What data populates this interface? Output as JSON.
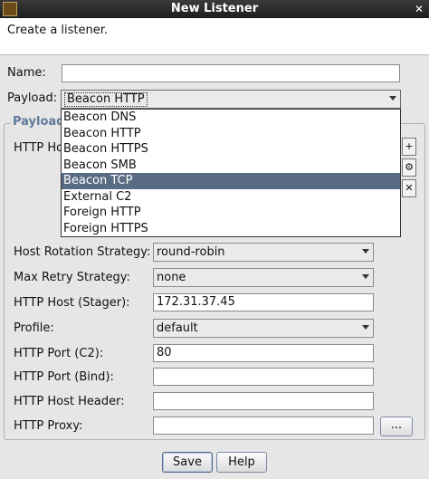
{
  "window": {
    "title": "New Listener",
    "close_glyph": "✕"
  },
  "header": {
    "text": "Create a listener."
  },
  "form": {
    "name_label": "Name:",
    "name_value": "",
    "payload_label": "Payload:",
    "payload_value": "Beacon HTTP",
    "group_title": "Payload",
    "partial_label": "HTTP Ho"
  },
  "dropdown": {
    "options": [
      "Beacon DNS",
      "Beacon HTTP",
      "Beacon HTTPS",
      "Beacon SMB",
      "Beacon TCP",
      "External C2",
      "Foreign HTTP",
      "Foreign HTTPS"
    ],
    "highlighted": "Beacon TCP"
  },
  "fields": [
    {
      "label": "Host Rotation Strategy:",
      "value": "round-robin",
      "type": "combo"
    },
    {
      "label": "Max Retry Strategy:",
      "value": "none",
      "type": "combo"
    },
    {
      "label": "HTTP Host (Stager):",
      "value": "172.31.37.45",
      "type": "input"
    },
    {
      "label": "Profile:",
      "value": "default",
      "type": "combo"
    },
    {
      "label": "HTTP Port (C2):",
      "value": "80",
      "type": "input"
    },
    {
      "label": "HTTP Port (Bind):",
      "value": "",
      "type": "input"
    },
    {
      "label": "HTTP Host Header:",
      "value": "",
      "type": "input"
    },
    {
      "label": "HTTP Proxy:",
      "value": "",
      "type": "input"
    }
  ],
  "proxy_button": "...",
  "side_buttons": [
    "+",
    "⚙",
    "✕"
  ],
  "buttons": {
    "save": "Save",
    "help": "Help"
  }
}
